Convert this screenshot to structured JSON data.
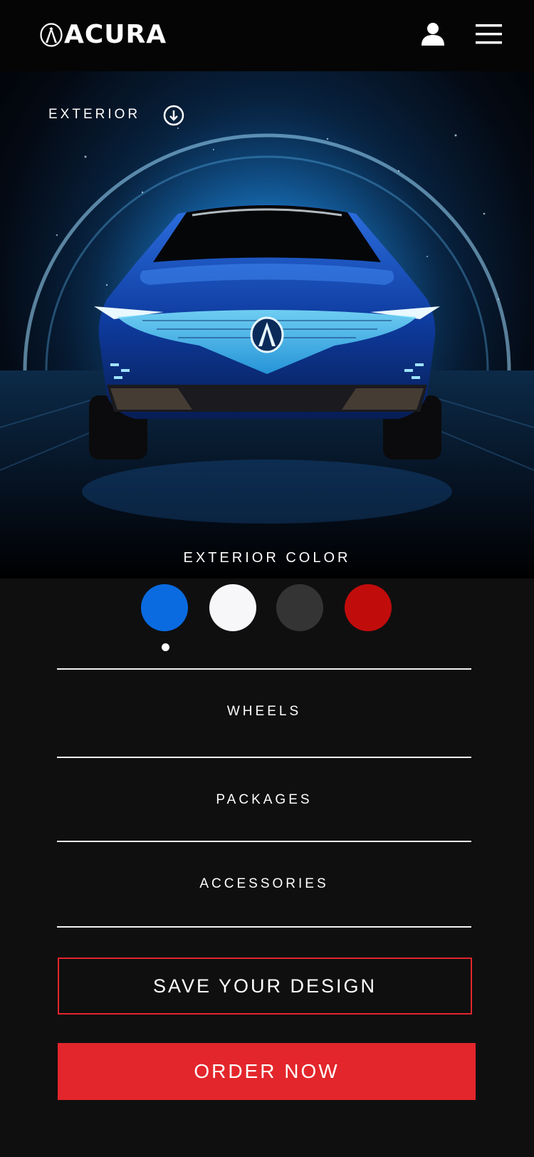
{
  "header": {
    "brand": "ACURA",
    "brand_icon": "acura-logo-icon",
    "account_icon": "account-icon",
    "menu_icon": "menu-icon"
  },
  "hero": {
    "view_label": "EXTERIOR",
    "view_toggle_icon": "download-circle-icon",
    "accent_color": "#2a8fd0"
  },
  "exterior_color": {
    "title": "EXTERIOR COLOR",
    "selected_index": 0,
    "swatches": [
      {
        "name": "blue",
        "color": "#0a6be0"
      },
      {
        "name": "white",
        "color": "#f7f7f9"
      },
      {
        "name": "gray",
        "color": "#343434"
      },
      {
        "name": "red",
        "color": "#c10c0c"
      }
    ]
  },
  "sections": [
    {
      "label": "WHEELS"
    },
    {
      "label": "PACKAGES"
    },
    {
      "label": "ACCESSORIES"
    }
  ],
  "actions": {
    "save_label": "SAVE YOUR DESIGN",
    "order_label": "ORDER NOW",
    "save_border_color": "#e3262b",
    "order_bg_color": "#e3262b"
  }
}
